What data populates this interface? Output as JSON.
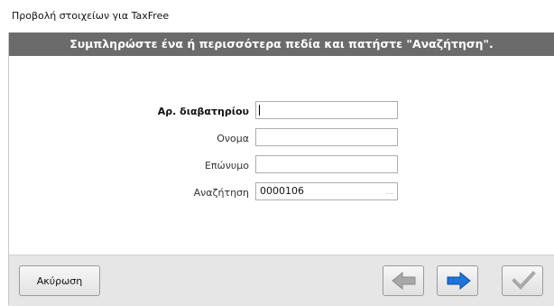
{
  "window": {
    "title": "Προβολή στοιχείων για TaxFree"
  },
  "header": {
    "text": "Συμπληρώστε ένα ή περισσότερα πεδία και πατήστε \"Αναζήτηση\"."
  },
  "form": {
    "passport": {
      "label": "Αρ. διαβατηρίου",
      "value": ""
    },
    "first_name": {
      "label": "Ονομα",
      "value": ""
    },
    "last_name": {
      "label": "Επώνυμο",
      "value": ""
    },
    "search": {
      "label": "Αναζήτηση",
      "value": "0000106",
      "button": "..."
    }
  },
  "footer": {
    "cancel_label": "Ακύρωση"
  },
  "icons": {
    "back": "left-arrow-icon",
    "forward": "right-arrow-icon",
    "confirm": "checkmark-icon"
  },
  "colors": {
    "header_bg": "#6b6b6b",
    "forward_arrow": "#1e74d8",
    "disabled": "#a8a8a8"
  }
}
